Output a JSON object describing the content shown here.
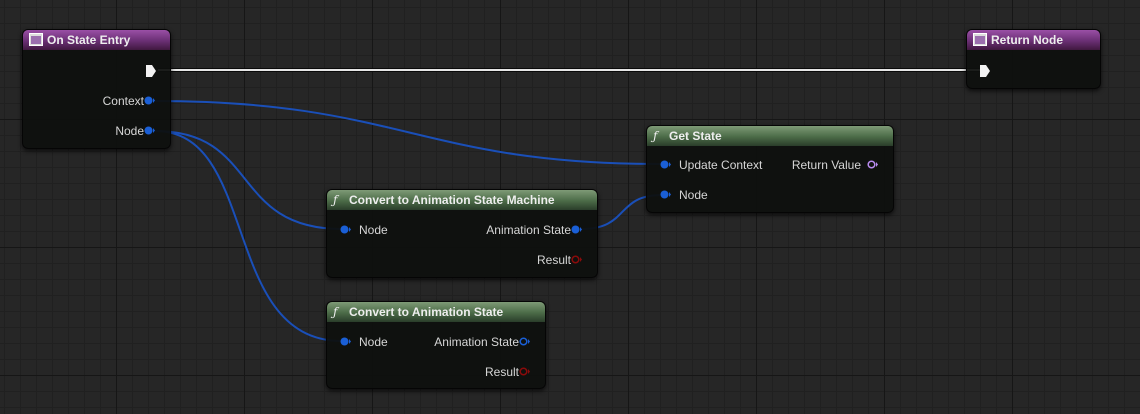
{
  "nodes": {
    "on_state_entry": {
      "title": "On State Entry",
      "pins": {
        "context": "Context",
        "node": "Node"
      }
    },
    "return_node": {
      "title": "Return Node"
    },
    "get_state": {
      "title": "Get State",
      "inputs": {
        "update_context": "Update Context",
        "node": "Node"
      },
      "outputs": {
        "return_value": "Return Value"
      }
    },
    "convert_state_machine": {
      "title": "Convert to Animation State Machine",
      "inputs": {
        "node": "Node"
      },
      "outputs": {
        "animation_state": "Animation State",
        "result": "Result"
      }
    },
    "convert_state": {
      "title": "Convert to Animation State",
      "inputs": {
        "node": "Node"
      },
      "outputs": {
        "animation_state": "Animation State",
        "result": "Result"
      }
    }
  },
  "colors": {
    "object_pin": "#1a5fd6",
    "struct_pin": "#b98cf0",
    "bool_pin": "#8a0b0b",
    "exec_wire": "#e8e8e8",
    "event_header": "#7a3a86",
    "function_header": "#55744e"
  }
}
